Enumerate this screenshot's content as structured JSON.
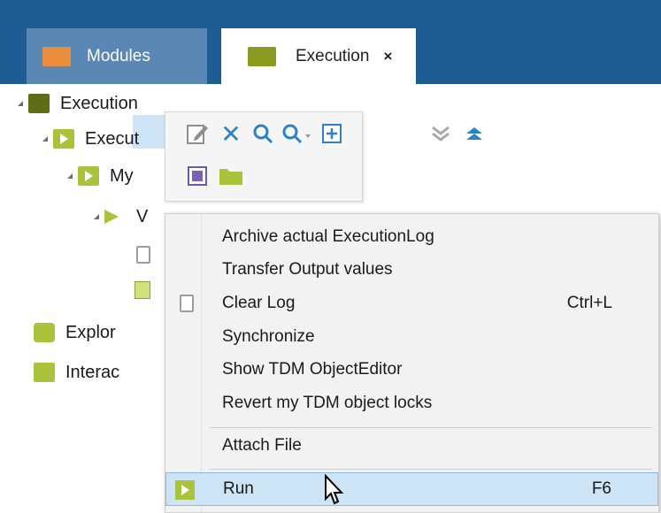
{
  "tabs": {
    "modules": {
      "label": "Modules"
    },
    "execution": {
      "label": "Execution",
      "close": "×"
    }
  },
  "tree": {
    "root": "Execution",
    "child1": "Execut",
    "child2": "My",
    "child3": "V",
    "explor": "Explor",
    "interac": "Interac"
  },
  "toolbar": {
    "icons": [
      "edit-icon",
      "delete-icon",
      "search-icon",
      "search-dropdown-icon",
      "expand-icon",
      "collapse-all-icon",
      "collapse-up-icon",
      "stop-icon",
      "folder-icon"
    ]
  },
  "context_menu": {
    "items": [
      {
        "label": "Archive actual ExecutionLog",
        "shortcut": ""
      },
      {
        "label": "Transfer Output values",
        "shortcut": ""
      },
      {
        "label": "Clear Log",
        "shortcut": "Ctrl+L"
      },
      {
        "label": "Synchronize",
        "shortcut": ""
      },
      {
        "label": "Show TDM ObjectEditor",
        "shortcut": ""
      },
      {
        "label": "Revert my TDM object locks",
        "shortcut": ""
      },
      {
        "label": "Attach File",
        "shortcut": ""
      },
      {
        "label": "Run",
        "shortcut": "F6"
      }
    ]
  },
  "colors": {
    "topbar": "#1d5d93",
    "accent": "#2d82c6",
    "run_highlight": "#cde3f6",
    "folder_green": "#8a9a21"
  }
}
